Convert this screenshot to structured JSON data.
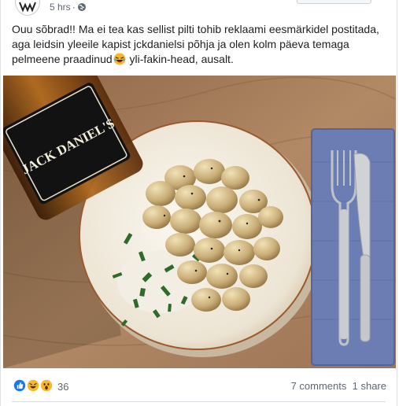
{
  "post": {
    "timestamp": "5 hrs",
    "separator": "·",
    "text_before_emoji": "Ouu sõbrad!! Ma ei tea kas sellist pilti tohib reklaami eesmärkidel postitada, aga leidsin yleeile kapist jckdanielsi põhja ja olen kolm päeva temaga pelmeene praadinud",
    "text_after_emoji": " yli-fakin-head, ausalt."
  },
  "photo": {
    "bottle_label": "JACK DANIEL'S"
  },
  "footer": {
    "reaction_count": "36",
    "comments": "7 comments",
    "shares": "1 share"
  },
  "colors": {
    "like_blue": "#1877f2",
    "haha_yellow": "#f7b928",
    "meta_gray": "#606770"
  },
  "icons": [
    "globe-icon",
    "like-reaction-icon",
    "haha-reaction-icon",
    "wow-reaction-icon",
    "laughing-emoji-icon"
  ]
}
